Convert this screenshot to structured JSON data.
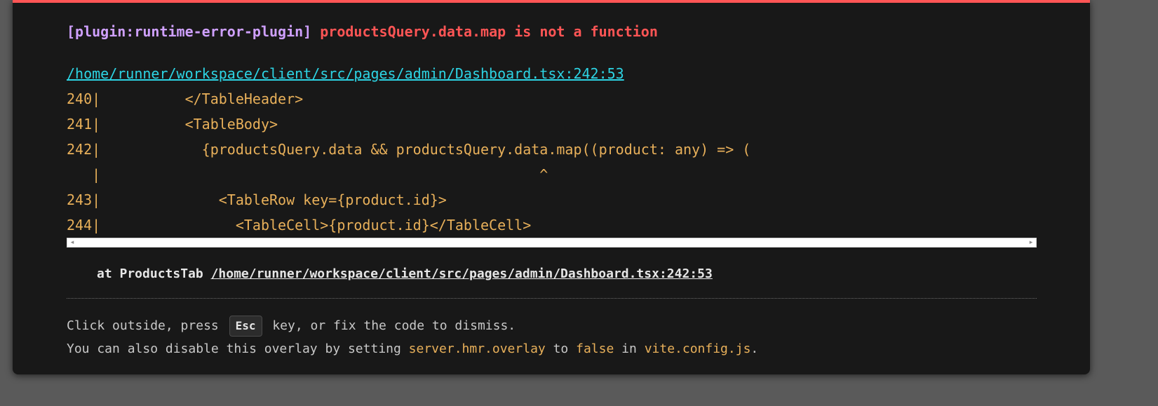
{
  "error": {
    "plugin": "[plugin:runtime-error-plugin]",
    "message": "productsQuery.data.map is not a function"
  },
  "file": {
    "path": "/home/runner/workspace/client/src/pages/admin/Dashboard.tsx:242:53"
  },
  "frame": {
    "lines": [
      "240|          </TableHeader>",
      "241|          <TableBody>",
      "242|            {productsQuery.data && productsQuery.data.map((product: any) => (",
      "   |                                                    ^",
      "243|              <TableRow key={product.id}>",
      "244|                <TableCell>{product.id}</TableCell>"
    ]
  },
  "stack": {
    "prefix": "at ProductsTab",
    "link": "/home/runner/workspace/client/src/pages/admin/Dashboard.tsx:242:53"
  },
  "tip": {
    "line1_part1": "Click outside, press",
    "key": "Esc",
    "line1_part2": "key, or fix the code to dismiss.",
    "line2_part1": "You can also disable this overlay by setting",
    "config_option": "server.hmr.overlay",
    "line2_part2": "to",
    "false_value": "false",
    "line2_part3": "in",
    "config_file": "vite.config.js",
    "line2_end": "."
  },
  "scrollbar": {
    "left_arrow": "◂",
    "right_arrow": "▸"
  },
  "colors": {
    "accent_border": "#ff5555",
    "plugin": "#cfa0ff",
    "message": "#ff5555",
    "link": "#2dd4e4",
    "code": "#e8b05a"
  }
}
